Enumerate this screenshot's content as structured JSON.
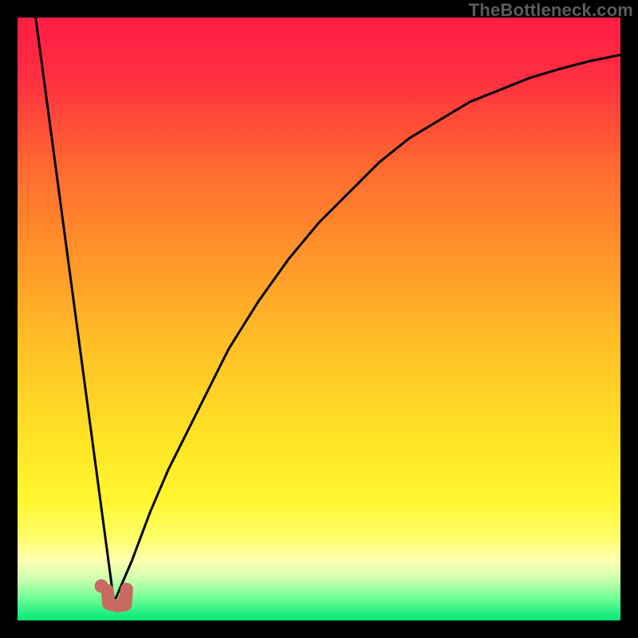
{
  "watermark": "TheBottleneck.com",
  "colors": {
    "frame": "#000000",
    "curve": "#000000",
    "marker_fill": "#c86a60",
    "marker_stroke": "#c86a60",
    "gradient_stops": [
      {
        "offset": 0.0,
        "color": "#ff1d44"
      },
      {
        "offset": 0.1,
        "color": "#ff2f41"
      },
      {
        "offset": 0.25,
        "color": "#ff6a2f"
      },
      {
        "offset": 0.4,
        "color": "#ff962a"
      },
      {
        "offset": 0.55,
        "color": "#ffc126"
      },
      {
        "offset": 0.7,
        "color": "#ffe326"
      },
      {
        "offset": 0.8,
        "color": "#fff62f"
      },
      {
        "offset": 0.86,
        "color": "#ffff66"
      },
      {
        "offset": 0.9,
        "color": "#ffffb0"
      },
      {
        "offset": 0.93,
        "color": "#d0ffb0"
      },
      {
        "offset": 0.96,
        "color": "#7aff9a"
      },
      {
        "offset": 1.0,
        "color": "#00e874"
      }
    ]
  },
  "chart_data": {
    "type": "line",
    "title": "",
    "xlabel": "",
    "ylabel": "",
    "xlim": [
      0,
      100
    ],
    "ylim": [
      0,
      100
    ],
    "note": "x is a normalized horizontal axis (0=left,100=right); y is 'goodness' (0=top red,100=bottom green). Both curves share a dip near x≈16 where y≈97.",
    "series": [
      {
        "name": "left-line",
        "x": [
          3,
          16
        ],
        "y": [
          0,
          97
        ]
      },
      {
        "name": "right-curve",
        "x": [
          16,
          19,
          22,
          25,
          30,
          35,
          40,
          45,
          50,
          55,
          60,
          65,
          70,
          75,
          80,
          85,
          90,
          95,
          100
        ],
        "y": [
          97,
          90,
          82,
          75,
          65,
          55,
          47,
          40,
          34,
          29,
          24,
          20,
          17,
          14,
          12,
          10,
          8.5,
          7.2,
          6.2
        ]
      }
    ],
    "markers": [
      {
        "name": "dip-marker-left",
        "x": 13.9,
        "y": 94.3
      },
      {
        "name": "dip-marker-right",
        "x": 17.8,
        "y": 96.4
      }
    ],
    "worm": {
      "note": "short salmon U-shaped stroke joining the two curve bottoms",
      "points": [
        {
          "x": 14.9,
          "y": 95.0
        },
        {
          "x": 15.1,
          "y": 97.2
        },
        {
          "x": 16.5,
          "y": 97.6
        },
        {
          "x": 17.9,
          "y": 97.4
        },
        {
          "x": 18.1,
          "y": 94.8
        }
      ]
    }
  }
}
